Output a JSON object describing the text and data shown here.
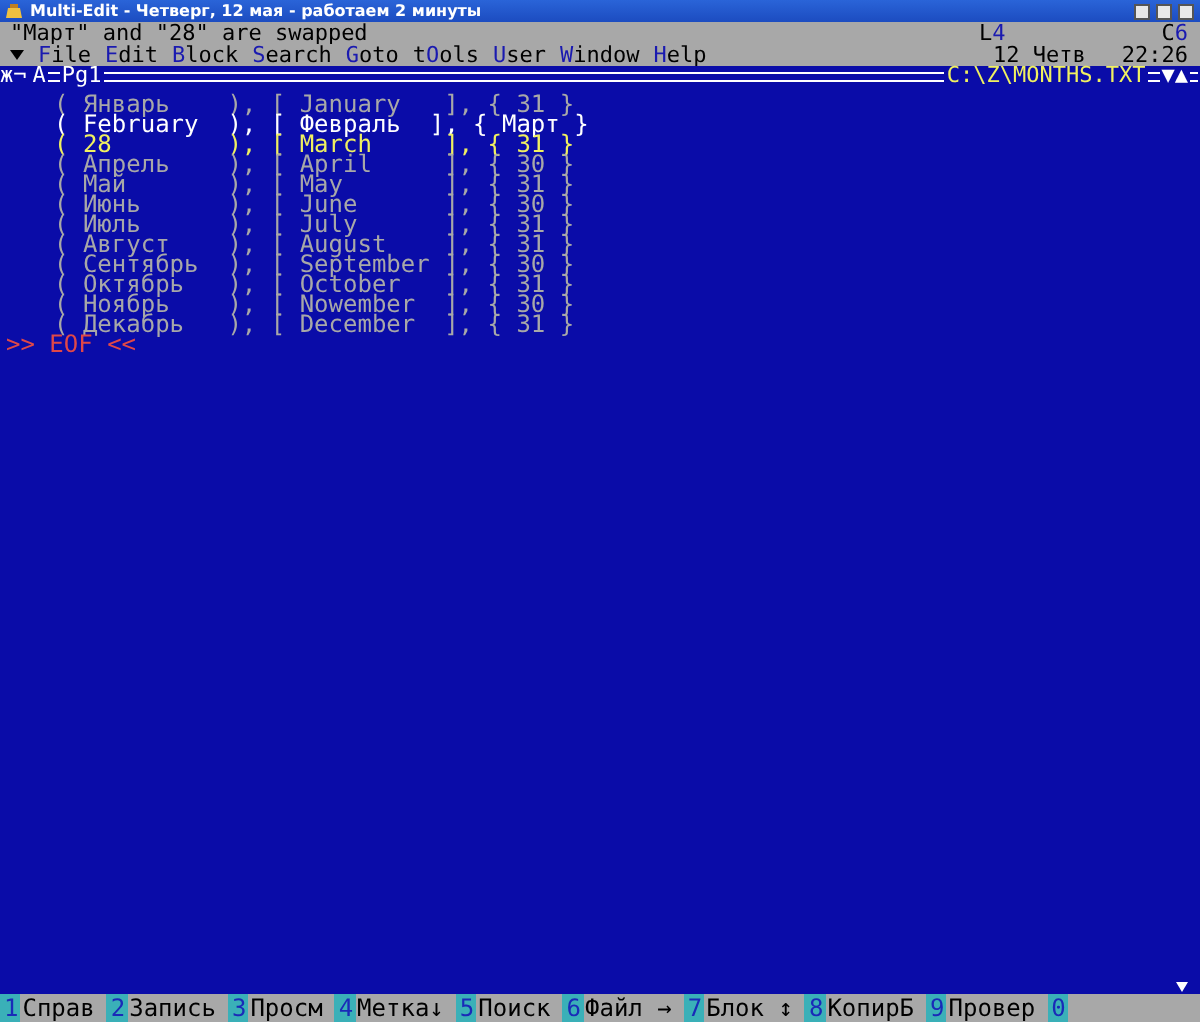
{
  "window": {
    "title": "Multi-Edit - Четверг, 12 мая - работаем 2 минуты"
  },
  "message": "\"Март\" and \"28\" are swapped",
  "position": {
    "line": {
      "label": "L",
      "value": "4"
    },
    "column": {
      "label": "C",
      "value": "6"
    }
  },
  "clock": {
    "date": "12 Четв",
    "time": "22:26"
  },
  "menu": [
    {
      "key": "F",
      "post": "ile"
    },
    {
      "key": "E",
      "post": "dit"
    },
    {
      "key": "B",
      "post": "lock"
    },
    {
      "key": "S",
      "post": "earch"
    },
    {
      "key": "G",
      "post": "oto"
    },
    {
      "pre": "t",
      "key": "O",
      "post": "ols"
    },
    {
      "key": "U",
      "post": "ser"
    },
    {
      "key": "W",
      "post": "indow"
    },
    {
      "key": "H",
      "post": "elp"
    }
  ],
  "frame": {
    "left_marks": "ж¬",
    "mode": "A",
    "page": "Pg1",
    "path": "C:\\Z\\MONTHS.TXT",
    "right_marks": "▼▲"
  },
  "lines": [
    {
      "text": "( Январь    ), [ January   ], { 31 }",
      "kind": "normal"
    },
    {
      "text": "( February  ), [ Февраль  ], { Март }",
      "kind": "bright"
    },
    {
      "text": "( 28        ), [ March     ], { 31 }",
      "kind": "current"
    },
    {
      "text": "( Апрель    ), [ April     ], { 30 }",
      "kind": "normal"
    },
    {
      "text": "( Май       ), [ May       ], { 31 }",
      "kind": "normal"
    },
    {
      "text": "( Июнь      ), [ June      ], { 30 }",
      "kind": "normal"
    },
    {
      "text": "( Июль      ), [ July      ], { 31 }",
      "kind": "normal"
    },
    {
      "text": "( Август    ), [ August    ], { 31 }",
      "kind": "normal"
    },
    {
      "text": "( Сентябрь  ), [ September ], { 30 }",
      "kind": "normal"
    },
    {
      "text": "( Октябрь   ), [ October   ], { 31 }",
      "kind": "normal"
    },
    {
      "text": "( Ноябрь    ), [ Nowember  ], { 30 }",
      "kind": "normal"
    },
    {
      "text": "( Декабрь   ), [ December  ], { 31 }",
      "kind": "normal"
    }
  ],
  "eof": ">> EOF <<",
  "function_keys": [
    {
      "num": "1",
      "label": "Справ"
    },
    {
      "num": "2",
      "label": "Запись"
    },
    {
      "num": "3",
      "label": "Просм"
    },
    {
      "num": "4",
      "label": "Метка↓"
    },
    {
      "num": "5",
      "label": "Поиск"
    },
    {
      "num": "6",
      "label": "Файл →"
    },
    {
      "num": "7",
      "label": "Блок ↕"
    },
    {
      "num": "8",
      "label": "КопирБ"
    },
    {
      "num": "9",
      "label": "Провер"
    },
    {
      "num": "0"
    }
  ]
}
